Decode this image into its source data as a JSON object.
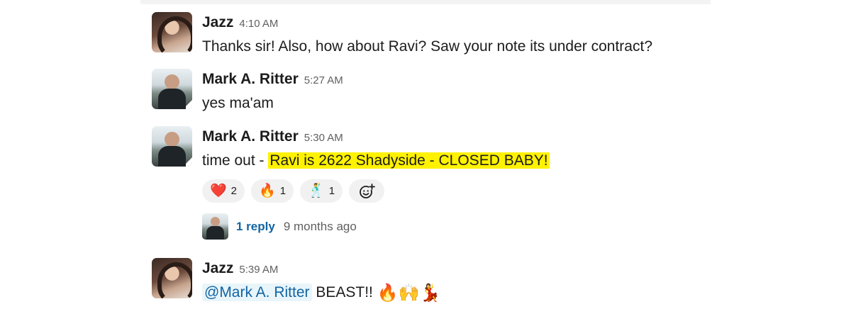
{
  "messages": [
    {
      "author": "Jazz",
      "time": "4:10 AM",
      "text": "Thanks sir! Also, how about Ravi? Saw your note its under contract?"
    },
    {
      "author": "Mark A. Ritter",
      "time": "5:27 AM",
      "text": "yes ma'am"
    },
    {
      "author": "Mark A. Ritter",
      "time": "5:30 AM",
      "text_prefix": "time out - ",
      "text_highlight": "Ravi is 2622 Shadyside - CLOSED BABY!",
      "reactions": [
        {
          "emoji": "❤️",
          "icon": "heart-icon",
          "count": "2"
        },
        {
          "emoji": "🔥",
          "icon": "fire-icon",
          "count": "1"
        },
        {
          "emoji": "🕺",
          "icon": "dancer-icon",
          "count": "1"
        }
      ],
      "thread": {
        "replies": "1 reply",
        "last_reply": "9 months ago"
      }
    },
    {
      "author": "Jazz",
      "time": "5:39 AM",
      "mention": "@Mark A. Ritter",
      "text": "BEAST!!",
      "emojis": [
        "🔥",
        "🙌",
        "💃"
      ]
    }
  ],
  "colors": {
    "highlight": "#fff200",
    "link": "#1264a3",
    "mention_bg": "#e8f5fa"
  }
}
